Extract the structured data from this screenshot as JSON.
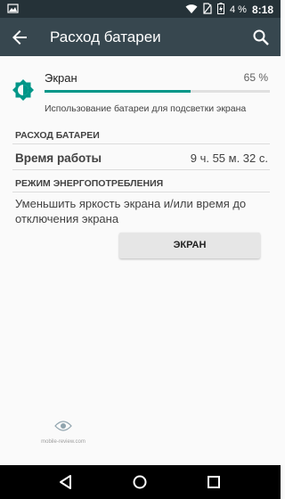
{
  "status_bar": {
    "battery_percent": "4 %",
    "time": "8:18",
    "icons": [
      "image-icon",
      "wifi-icon",
      "no-sim-icon",
      "battery-charging-icon"
    ]
  },
  "toolbar": {
    "title": "Расход батареи",
    "back_icon": "arrow-back-icon",
    "search_icon": "search-icon"
  },
  "screen_usage": {
    "label": "Экран",
    "percent_text": "65 %",
    "percent_value": 65,
    "description": "Использование батареи для подсветки экрана",
    "icon": "brightness-icon",
    "accent_color": "#009688"
  },
  "battery_section": {
    "header": "РАСХОД БАТАРЕИ",
    "uptime_label": "Время работы",
    "uptime_value": "9 ч. 55 м. 32 с."
  },
  "power_mode_section": {
    "header": "РЕЖИМ ЭНЕРГОПОТРЕБЛЕНИЯ",
    "description": "Уменьшить яркость экрана и/или время до отключения экрана",
    "button_label": "ЭКРАН"
  },
  "watermark": {
    "text": "mobile-review.com"
  },
  "nav_bar": {
    "back_icon": "nav-back-icon",
    "home_icon": "nav-home-icon",
    "recents_icon": "nav-recents-icon"
  }
}
